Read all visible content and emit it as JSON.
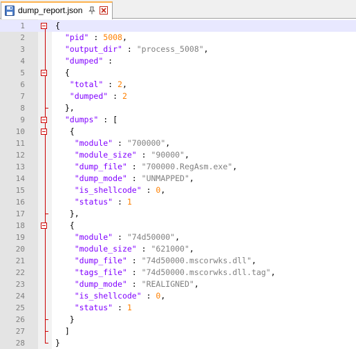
{
  "tab": {
    "title": "dump_report.json",
    "icon": "floppy-disk-icon",
    "pin_icon": "pin-icon",
    "close_icon": "close-icon",
    "accent": "#fdb24d"
  },
  "colors": {
    "key": "#8000ff",
    "string": "#808080",
    "number": "#ff8000",
    "fold": "#cc0000",
    "gutter": "#e4e4e4",
    "current_line": "#e8e8ff"
  },
  "editor": {
    "lines": [
      {
        "num": "1",
        "text": "{"
      },
      {
        "num": "2",
        "text": "  \"pid\" : 5008,"
      },
      {
        "num": "3",
        "text": "  \"output_dir\" : \"process_5008\","
      },
      {
        "num": "4",
        "text": "  \"dumped\" :"
      },
      {
        "num": "5",
        "text": "  {"
      },
      {
        "num": "6",
        "text": "   \"total\" : 2,"
      },
      {
        "num": "7",
        "text": "   \"dumped\" : 2"
      },
      {
        "num": "8",
        "text": "  },"
      },
      {
        "num": "9",
        "text": "  \"dumps\" : ["
      },
      {
        "num": "10",
        "text": "   {"
      },
      {
        "num": "11",
        "text": "    \"module\" : \"700000\","
      },
      {
        "num": "12",
        "text": "    \"module_size\" : \"90000\","
      },
      {
        "num": "13",
        "text": "    \"dump_file\" : \"700000.RegAsm.exe\","
      },
      {
        "num": "14",
        "text": "    \"dump_mode\" : \"UNMAPPED\","
      },
      {
        "num": "15",
        "text": "    \"is_shellcode\" : 0,"
      },
      {
        "num": "16",
        "text": "    \"status\" : 1"
      },
      {
        "num": "17",
        "text": "   },"
      },
      {
        "num": "18",
        "text": "   {"
      },
      {
        "num": "19",
        "text": "    \"module\" : \"74d50000\","
      },
      {
        "num": "20",
        "text": "    \"module_size\" : \"621000\","
      },
      {
        "num": "21",
        "text": "    \"dump_file\" : \"74d50000.mscorwks.dll\","
      },
      {
        "num": "22",
        "text": "    \"tags_file\" : \"74d50000.mscorwks.dll.tag\","
      },
      {
        "num": "23",
        "text": "    \"dump_mode\" : \"REALIGNED\","
      },
      {
        "num": "24",
        "text": "    \"is_shellcode\" : 0,"
      },
      {
        "num": "25",
        "text": "    \"status\" : 1"
      },
      {
        "num": "26",
        "text": "   }"
      },
      {
        "num": "27",
        "text": "  ]"
      },
      {
        "num": "28",
        "text": "}"
      }
    ]
  }
}
